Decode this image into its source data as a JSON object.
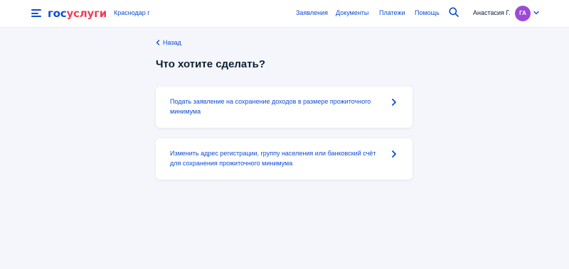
{
  "header": {
    "logo": {
      "part1": "гос",
      "part2": "услуги"
    },
    "city": "Краснодар г",
    "nav": [
      {
        "label": "Заявления"
      },
      {
        "label": "Документы"
      },
      {
        "label": "Платежи"
      },
      {
        "label": "Помощь"
      }
    ],
    "user": {
      "name": "Анастасия Г.",
      "initials": "ГА"
    }
  },
  "main": {
    "back_label": "Назад",
    "title": "Что хотите сделать?",
    "options": [
      {
        "label": "Подать заявление на сохранение доходов в размере прожиточного минимума"
      },
      {
        "label": "Изменить адрес регистрации, группу населения или банковский счёт для сохранения прожиточного минимума"
      }
    ]
  },
  "colors": {
    "link": "#0d4cd3",
    "brand_red": "#ee3f58",
    "avatar": "#9d4ad6",
    "page_bg": "#f4f6fb"
  },
  "icons": [
    "menu-icon",
    "search-icon",
    "chevron-down-icon",
    "chevron-left-icon",
    "chevron-right-icon"
  ]
}
